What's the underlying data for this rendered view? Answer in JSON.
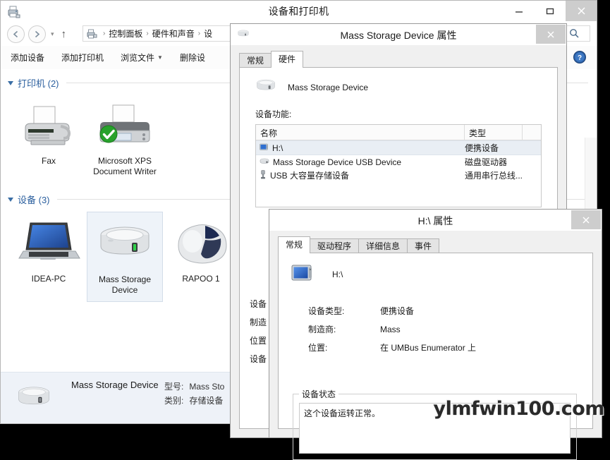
{
  "explorer": {
    "title": "设备和打印机",
    "window_buttons": {
      "minimize": "–",
      "maximize": "□",
      "close": "✕"
    },
    "breadcrumb": {
      "root_icon": "devices-printers-icon",
      "items": [
        "控制面板",
        "硬件和声音",
        "设"
      ],
      "separator": "›"
    },
    "nav": {
      "back": "←",
      "forward": "→",
      "history": "▾",
      "up": "↑"
    },
    "search_icon": "search-icon",
    "help_icon": "help-icon",
    "toolbar": [
      {
        "label": "添加设备",
        "has_caret": false
      },
      {
        "label": "添加打印机",
        "has_caret": false
      },
      {
        "label": "浏览文件",
        "has_caret": true
      },
      {
        "label": "删除设",
        "has_caret": false
      }
    ],
    "sections": [
      {
        "title": "打印机 (2)",
        "items": [
          {
            "label": "Fax",
            "icon": "fax-icon",
            "selected": false,
            "badge": null
          },
          {
            "label": "Microsoft XPS Document Writer",
            "icon": "printer-icon",
            "selected": false,
            "badge": "green-check-badge"
          }
        ]
      },
      {
        "title": "设备 (3)",
        "items": [
          {
            "label": "IDEA-PC",
            "icon": "laptop-icon",
            "selected": false,
            "badge": null
          },
          {
            "label": "Mass Storage Device",
            "icon": "external-drive-icon",
            "selected": true,
            "badge": null
          },
          {
            "label": "RAPOO 1",
            "icon": "mouse-icon",
            "selected": false,
            "badge": null
          }
        ]
      }
    ],
    "status": {
      "icon": "external-drive-icon",
      "name": "Mass Storage Device",
      "fields": [
        {
          "key": "型号:",
          "value": "Mass Sto"
        },
        {
          "key": "类别:",
          "value": "存储设备"
        }
      ]
    }
  },
  "mass_storage_dialog": {
    "title": "Mass Storage Device 属性",
    "icon": "external-drive-icon",
    "close": "✕",
    "tabs": [
      {
        "label": "常规",
        "active": false
      },
      {
        "label": "硬件",
        "active": true
      }
    ],
    "device_name": "Mass Storage Device",
    "device_icon": "external-drive-icon",
    "functions_label": "设备功能:",
    "list_headers": [
      "名称",
      "类型",
      ""
    ],
    "list_rows": [
      {
        "name": "H:\\",
        "type": "便携设备",
        "icon": "portable-device-icon",
        "selected": true
      },
      {
        "name": "Mass Storage Device USB Device",
        "type": "磁盘驱动器",
        "icon": "disk-drive-icon",
        "selected": false
      },
      {
        "name": "USB 大容量存储设备",
        "type": "通用串行总线...",
        "icon": "usb-icon",
        "selected": false
      }
    ],
    "obscured_labels": [
      "设备",
      "制造",
      "位置",
      "设备"
    ]
  },
  "drive_dialog": {
    "title": "H:\\ 属性",
    "close": "✕",
    "tabs": [
      {
        "label": "常规",
        "active": true
      },
      {
        "label": "驱动程序",
        "active": false
      },
      {
        "label": "详细信息",
        "active": false
      },
      {
        "label": "事件",
        "active": false
      }
    ],
    "device_name": "H:\\",
    "device_icon": "portable-device-icon",
    "properties": [
      {
        "key": "设备类型:",
        "value": "便携设备"
      },
      {
        "key": "制造商:",
        "value": "Mass"
      },
      {
        "key": "位置:",
        "value": "在 UMBus Enumerator 上"
      }
    ],
    "status_group_label": "设备状态",
    "status_text": "这个设备运转正常。",
    "scroll_up_arrow": "︿"
  },
  "watermark": "ylmfwin100.com",
  "colors": {
    "accent_blue": "#2b5f9e",
    "selection": "#eef3f9",
    "window_bg": "#f0f0f0",
    "content_bg": "#ffffff",
    "status_bg": "#eef2f8",
    "close_button": "#cdcdcd"
  }
}
